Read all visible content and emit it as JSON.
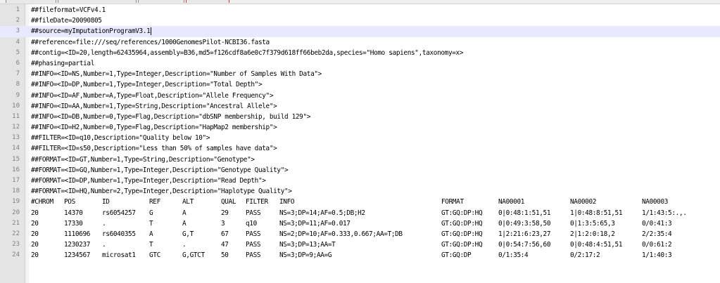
{
  "editor": {
    "meta_lines": [
      {
        "n": "1",
        "text": "##fileformat=VCFv4.1"
      },
      {
        "n": "2",
        "text": "##fileDate=20090805"
      },
      {
        "n": "3",
        "text": "##source=myImputationProgramV3.1"
      },
      {
        "n": "4",
        "text": "##reference=file:///seq/references/1000GenomesPilot-NCBI36.fasta"
      },
      {
        "n": "5",
        "text": "##contig=<ID=20,length=62435964,assembly=B36,md5=f126cdf8a6e0c7f379d618ff66beb2da,species=\"Homo sapiens\",taxonomy=x>"
      },
      {
        "n": "6",
        "text": "##phasing=partial"
      },
      {
        "n": "7",
        "text": "##INFO=<ID=NS,Number=1,Type=Integer,Description=\"Number of Samples With Data\">"
      },
      {
        "n": "8",
        "text": "##INFO=<ID=DP,Number=1,Type=Integer,Description=\"Total Depth\">"
      },
      {
        "n": "9",
        "text": "##INFO=<ID=AF,Number=A,Type=Float,Description=\"Allele Frequency\">"
      },
      {
        "n": "10",
        "text": "##INFO=<ID=AA,Number=1,Type=String,Description=\"Ancestral Allele\">"
      },
      {
        "n": "11",
        "text": "##INFO=<ID=DB,Number=0,Type=Flag,Description=\"dbSNP membership, build 129\">"
      },
      {
        "n": "12",
        "text": "##INFO=<ID=H2,Number=0,Type=Flag,Description=\"HapMap2 membership\">"
      },
      {
        "n": "13",
        "text": "##FILTER=<ID=q10,Description=\"Quality below 10\">"
      },
      {
        "n": "14",
        "text": "##FILTER=<ID=s50,Description=\"Less than 50% of samples have data\">"
      },
      {
        "n": "15",
        "text": "##FORMAT=<ID=GT,Number=1,Type=String,Description=\"Genotype\">"
      },
      {
        "n": "16",
        "text": "##FORMAT=<ID=GQ,Number=1,Type=Integer,Description=\"Genotype Quality\">"
      },
      {
        "n": "17",
        "text": "##FORMAT=<ID=DP,Number=1,Type=Integer,Description=\"Read Depth\">"
      },
      {
        "n": "18",
        "text": "##FORMAT=<ID=HQ,Number=2,Type=Integer,Description=\"Haplotype Quality\">"
      }
    ],
    "current_line": "3",
    "table_header": {
      "n": "19",
      "cols": [
        "#CHROM",
        "POS",
        "ID",
        "REF",
        "ALT",
        "QUAL",
        "FILTER",
        "INFO",
        "FORMAT",
        "NA00001",
        "NA00002",
        "NA00003"
      ]
    },
    "table_rows": [
      {
        "n": "20",
        "cells": [
          "20",
          "14370",
          "rs6054257",
          "G",
          "A",
          "29",
          "PASS",
          "NS=3;DP=14;AF=0.5;DB;H2",
          "GT:GQ:DP:HQ",
          "0|0:48:1:51,51",
          "1|0:48:8:51,51",
          "1/1:43:5:.,."
        ]
      },
      {
        "n": "21",
        "cells": [
          "20",
          "17330",
          ".",
          "T",
          "A",
          "3",
          "q10",
          "NS=3;DP=11;AF=0.017",
          "GT:GQ:DP:HQ",
          "0|0:49:3:58,50",
          "0|1:3:5:65,3",
          "0/0:41:3"
        ]
      },
      {
        "n": "22",
        "cells": [
          "20",
          "1110696",
          "rs6040355",
          "A",
          "G,T",
          "67",
          "PASS",
          "NS=2;DP=10;AF=0.333,0.667;AA=T;DB",
          "GT:GQ:DP:HQ",
          "1|2:21:6:23,27",
          "2|1:2:0:18,2",
          "2/2:35:4"
        ]
      },
      {
        "n": "23",
        "cells": [
          "20",
          "1230237",
          ".",
          "T",
          ".",
          "47",
          "PASS",
          "NS=3;DP=13;AA=T",
          "GT:GQ:DP:HQ",
          "0|0:54:7:56,60",
          "0|0:48:4:51,51",
          "0/0:61:2"
        ]
      },
      {
        "n": "24",
        "cells": [
          "20",
          "1234567",
          "microsat1",
          "GTC",
          "G,GTCT",
          "50",
          "PASS",
          "NS=3;DP=9;AA=G",
          "GT:GQ:DP",
          "0/1:35:4",
          "0/2:17:2",
          "1/1:40:3"
        ]
      }
    ]
  }
}
